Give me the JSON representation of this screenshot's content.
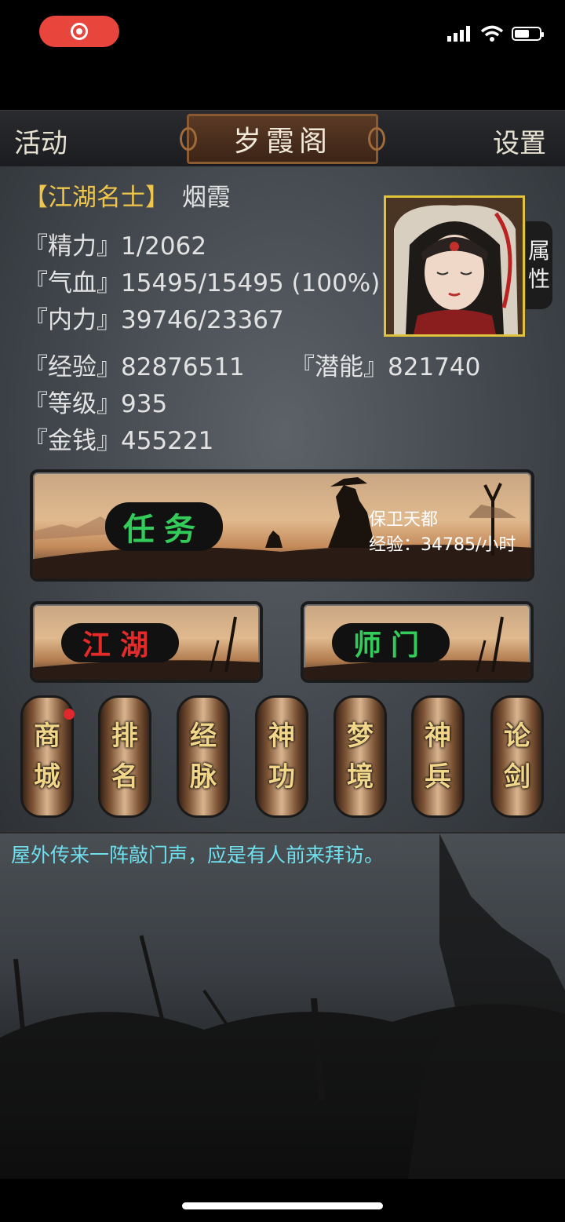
{
  "status_bar": {
    "battery_level": 0.6
  },
  "header": {
    "left": "活动",
    "title": "岁霞阁",
    "right": "设置"
  },
  "player": {
    "rank_title": "【江湖名士】",
    "name": "烟霞",
    "stats": {
      "energy": "『精力』1/2062",
      "hp": "『气血』15495/15495 (100%)",
      "mp": "『内力』39746/23367",
      "exp": "『经验』82876511",
      "potential": "『潜能』821740",
      "level": "『等级』935",
      "money": "『金钱』455221"
    },
    "attr_tab": [
      "属",
      "性"
    ]
  },
  "quest": {
    "label": "任务",
    "name": "保卫天都",
    "rate": "经验：34785/小时"
  },
  "sub_banners": {
    "jianghu": "江湖",
    "shimen": "师门"
  },
  "menu": [
    {
      "top": "商",
      "bottom": "城"
    },
    {
      "top": "排",
      "bottom": "名"
    },
    {
      "top": "经",
      "bottom": "脉"
    },
    {
      "top": "神",
      "bottom": "功"
    },
    {
      "top": "梦",
      "bottom": "境"
    },
    {
      "top": "神",
      "bottom": "兵"
    },
    {
      "top": "论",
      "bottom": "剑"
    }
  ],
  "log": {
    "message": "屋外传来一阵敲门声，应是有人前来拜访。"
  },
  "colors": {
    "rank": "#f0c64a",
    "jianghu_text": "#e52a2a",
    "green_text": "#33cc5a",
    "log_text": "#6fe0ee"
  }
}
